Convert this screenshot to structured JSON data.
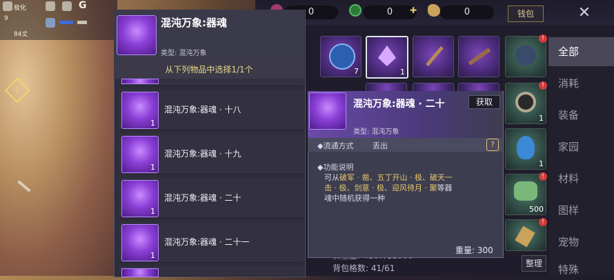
{
  "hud": {
    "location": "极化",
    "stat_1": "9",
    "stat_2": "84丈",
    "tag_g": "G"
  },
  "currency": {
    "gem": "0",
    "jade": "0",
    "seed": "0",
    "wallet_label": "钱包"
  },
  "selection_panel": {
    "title": "混沌万象:器魂",
    "type_label": "类型: 混沌万象",
    "instruction": "从下列物品中选择1/1个",
    "items": [
      {
        "name": "混沌万象:器魂 · 十八",
        "count": "1"
      },
      {
        "name": "混沌万象:器魂 · 十九",
        "count": "1"
      },
      {
        "name": "混沌万象:器魂 · 二十",
        "count": "1"
      },
      {
        "name": "混沌万象:器魂 · 二十一",
        "count": "1"
      }
    ],
    "peek_count": "1"
  },
  "detail_popup": {
    "title": "混沌万象:器魂 · 二十",
    "get_button": "获取",
    "type_label": "类型: 混沌万象",
    "circulation_label": "◆流通方式",
    "circulation_value": "丢出",
    "function_label": "◆功能说明",
    "desc_lines": [
      {
        "prefix": "可从",
        "highlight": "破军 · 凿、五丁开山 · 极、破天一",
        "suffix": ""
      },
      {
        "prefix": "",
        "highlight": "击 · 极、剑意 · 极、迎风待月 · 聚",
        "suffix": "等器"
      },
      {
        "prefix": "魂中随机获得一种",
        "highlight": "",
        "suffix": ""
      }
    ],
    "weight": "重量: 300"
  },
  "inventory": {
    "row1": [
      {
        "count": "7",
        "badge": ""
      },
      {
        "count": "1",
        "badge": ""
      },
      {
        "count": "",
        "badge": ""
      },
      {
        "count": "",
        "badge": ""
      },
      {
        "count": "",
        "badge": "!"
      }
    ],
    "side_slots": [
      {
        "count": "1",
        "badge": "!"
      },
      {
        "count": "1",
        "badge": ""
      },
      {
        "count": "500",
        "badge": "!"
      },
      {
        "count": "",
        "badge": "!"
      }
    ],
    "footer_weight": "负重量: 4167/11000",
    "bag_count": "背包格数: 41/61",
    "sort_button": "整理"
  },
  "tabs": [
    {
      "label": "全部",
      "active": true
    },
    {
      "label": "消耗",
      "active": false
    },
    {
      "label": "装备",
      "active": false
    },
    {
      "label": "家园",
      "active": false
    },
    {
      "label": "材料",
      "active": false
    },
    {
      "label": "图样",
      "active": false
    },
    {
      "label": "宠物",
      "active": false
    },
    {
      "label": "特殊",
      "active": false
    }
  ],
  "colors": {
    "accent_purple": "#8a3fd6",
    "highlight_gold": "#e7c86a",
    "badge_red": "#d23b3b"
  }
}
